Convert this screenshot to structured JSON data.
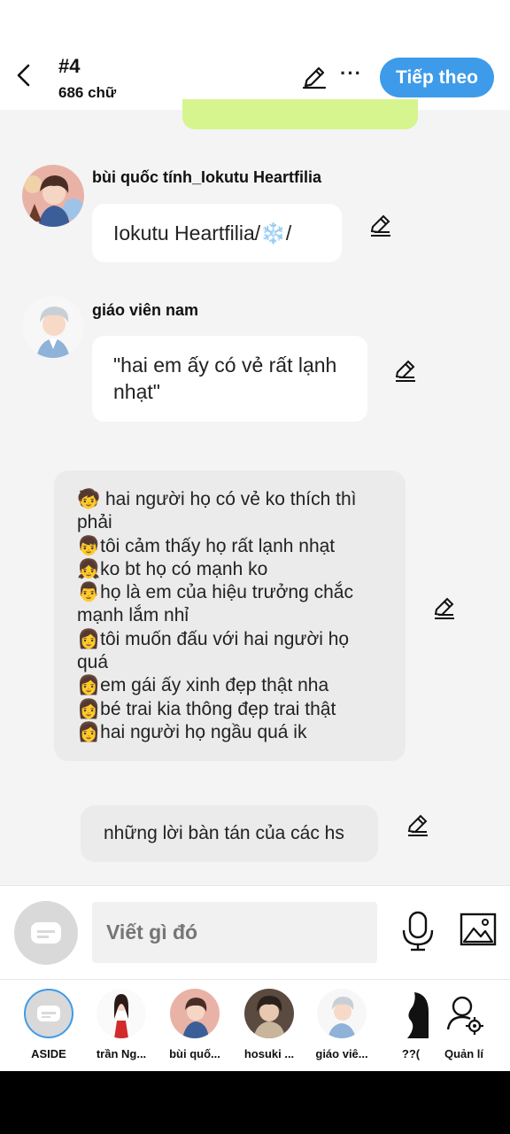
{
  "header": {
    "title": "#4",
    "word_count": "686 chữ",
    "next_label": "Tiếp theo",
    "more_symbol": "···"
  },
  "messages": [
    {
      "speaker": "bùi quốc tính_Iokutu Heartfilia",
      "text": "Iokutu Heartfilia/❄️/"
    },
    {
      "speaker": "giáo viên nam",
      "text": "\"hai em ấy có vẻ rất lạnh nhạt\""
    }
  ],
  "narration_lines": [
    "🧒 hai người họ có vẻ ko thích thì phải",
    "👦tôi cảm thấy họ rất lạnh nhạt",
    "👧ko bt họ có mạnh ko",
    "👨họ là em của hiệu trưởng chắc mạnh lắm nhỉ",
    "👩tôi muốn đấu với hai người họ quá",
    "👩em gái ấy xinh đẹp thật nha",
    "👩bé trai kia thông đẹp trai thật",
    "👩hai người họ ngầu quá ik"
  ],
  "narration_2": "những lời bàn tán của các hs",
  "composer": {
    "placeholder": "Viết gì đó"
  },
  "characters": [
    {
      "label": "ASIDE"
    },
    {
      "label": "trần Ng..."
    },
    {
      "label": "bùi quố..."
    },
    {
      "label": "hosuki ..."
    },
    {
      "label": "giáo viê..."
    },
    {
      "label": "??("
    },
    {
      "label": "Quản lí"
    }
  ],
  "colors": {
    "accent": "#3e9be9",
    "green_bubble": "#d6f58f",
    "background": "#f4f4f4"
  }
}
